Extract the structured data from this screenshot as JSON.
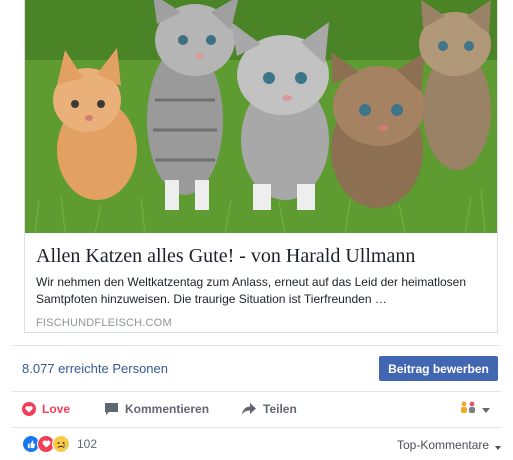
{
  "link_preview": {
    "title": "Allen Katzen alles Gute! - von Harald Ullmann",
    "description": "Wir nehmen den Weltkatzentag zum Anlass, erneut auf das Leid der heimatlosen Samtpfoten hinzuweisen. Die traurige Situation ist Tierfreunden …",
    "domain": "FISCHUNDFLEISCH.COM"
  },
  "reach": {
    "label": "8.077 erreichte Personen",
    "boost_label": "Beitrag bewerben"
  },
  "actions": {
    "love": "Love",
    "comment": "Kommentieren",
    "share": "Teilen"
  },
  "reactions": {
    "count": "102",
    "types": [
      "like",
      "love",
      "sad"
    ],
    "sort_label": "Top-Kommentare"
  },
  "colors": {
    "link": "#365899",
    "primary_button": "#4267b2",
    "love": "#f33e58"
  }
}
